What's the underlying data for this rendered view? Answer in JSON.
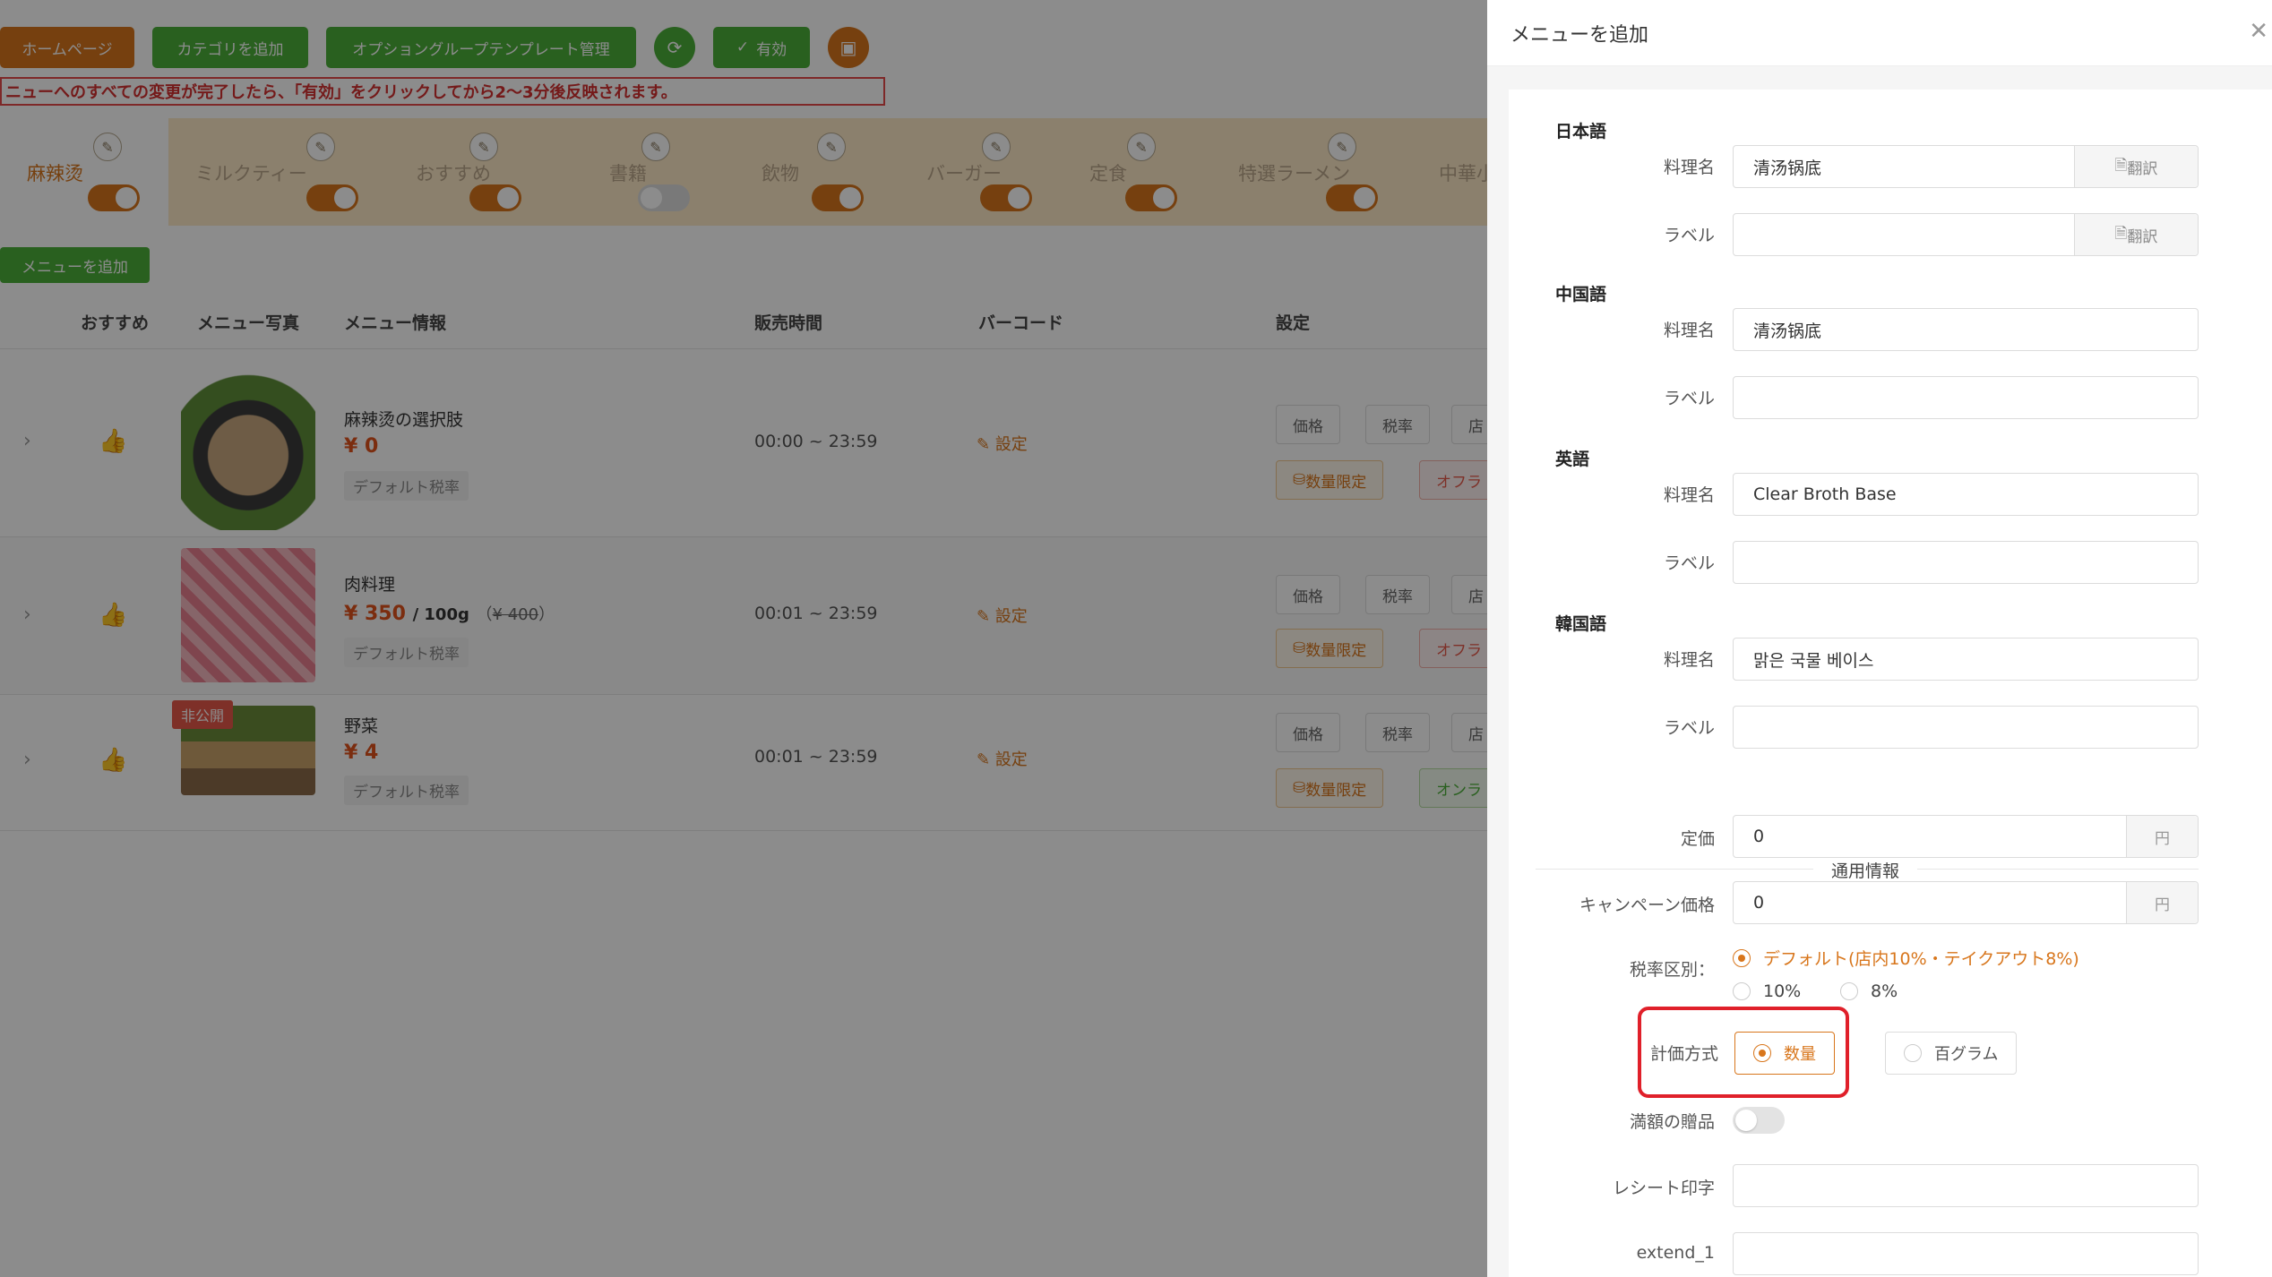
{
  "top_buttons": {
    "home": "ホームページ",
    "add_category": "カテゴリを追加",
    "option_group": "オプショングループテンプレート管理",
    "refresh_icon": "refresh-icon",
    "enable": "有効",
    "qr_icon": "qr-icon"
  },
  "notice": "ニューへのすべての変更が完了したら、「有効」をクリックしてから2〜3分後反映されます。",
  "categories": [
    {
      "name": "麻辣烫",
      "enabled": true
    },
    {
      "name": "ミルクティー",
      "enabled": true
    },
    {
      "name": "おすすめ",
      "enabled": true
    },
    {
      "name": "書籍",
      "enabled": false
    },
    {
      "name": "飲物",
      "enabled": true
    },
    {
      "name": "バーガー",
      "enabled": true
    },
    {
      "name": "定食",
      "enabled": true
    },
    {
      "name": "特選ラーメン",
      "enabled": true
    },
    {
      "name": "中華小",
      "enabled": true
    }
  ],
  "add_menu_button": "メニューを追加",
  "table": {
    "headers": [
      "おすすめ",
      "メニュー写真",
      "メニュー情報",
      "販売時間",
      "バーコード",
      "設定"
    ],
    "rows": [
      {
        "name": "麻辣烫の選択肢",
        "price": "¥ 0",
        "price_unit": "",
        "orig_price": "",
        "tax": "デフォルト税率",
        "time": "00:00 ~ 23:59",
        "barcode": "設定",
        "private": ""
      },
      {
        "name": "肉料理",
        "price": "¥ 350",
        "price_unit": "/ 100g",
        "orig_price": "¥ 400",
        "tax": "デフォルト税率",
        "time": "00:01 ~ 23:59",
        "barcode": "設定",
        "private": ""
      },
      {
        "name": "野菜",
        "price": "¥ 4",
        "price_unit": "",
        "orig_price": "",
        "tax": "デフォルト税率",
        "time": "00:01 ~ 23:59",
        "barcode": "設定",
        "private": "非公開"
      }
    ],
    "setting_buttons": {
      "price": "価格",
      "tax": "税率",
      "store": "店",
      "qty_limit": "数量限定",
      "off": "オフラ",
      "on": "オンラ"
    }
  },
  "drawer": {
    "title": "メニューを追加",
    "translate": "翻訳",
    "languages": {
      "ja": {
        "title": "日本語",
        "dish_label": "料理名",
        "dish_value": "清汤锅底",
        "tag_label": "ラベル",
        "tag_value": ""
      },
      "zh": {
        "title": "中国語",
        "dish_label": "料理名",
        "dish_value": "清汤锅底",
        "tag_label": "ラベル",
        "tag_value": ""
      },
      "en": {
        "title": "英語",
        "dish_label": "料理名",
        "dish_value": "Clear Broth Base",
        "tag_label": "ラベル",
        "tag_value": ""
      },
      "ko": {
        "title": "韓国語",
        "dish_label": "料理名",
        "dish_value": "맑은 국물 베이스",
        "tag_label": "ラベル",
        "tag_value": ""
      }
    },
    "common_info": "通用情報",
    "list_price": {
      "label": "定価",
      "value": "0",
      "unit": "円"
    },
    "campaign_price": {
      "label": "キャンペーン価格",
      "value": "0",
      "unit": "円"
    },
    "tax_type": {
      "label": "税率区別：",
      "options": [
        "デフォルト(店内10%・テイクアウト8%)",
        "10%",
        "8%"
      ],
      "selected": 0
    },
    "pricing_method": {
      "label": "計価方式",
      "options": [
        "数量",
        "百グラム"
      ],
      "selected": 0
    },
    "gift": {
      "label": "満額の贈品",
      "enabled": false
    },
    "receipt": {
      "label": "レシート印字",
      "value": ""
    },
    "extend_1": {
      "label": "extend_1",
      "value": ""
    }
  },
  "colors": {
    "accent": "#d8761c",
    "green": "#4caf3a",
    "red": "#e0202a"
  }
}
